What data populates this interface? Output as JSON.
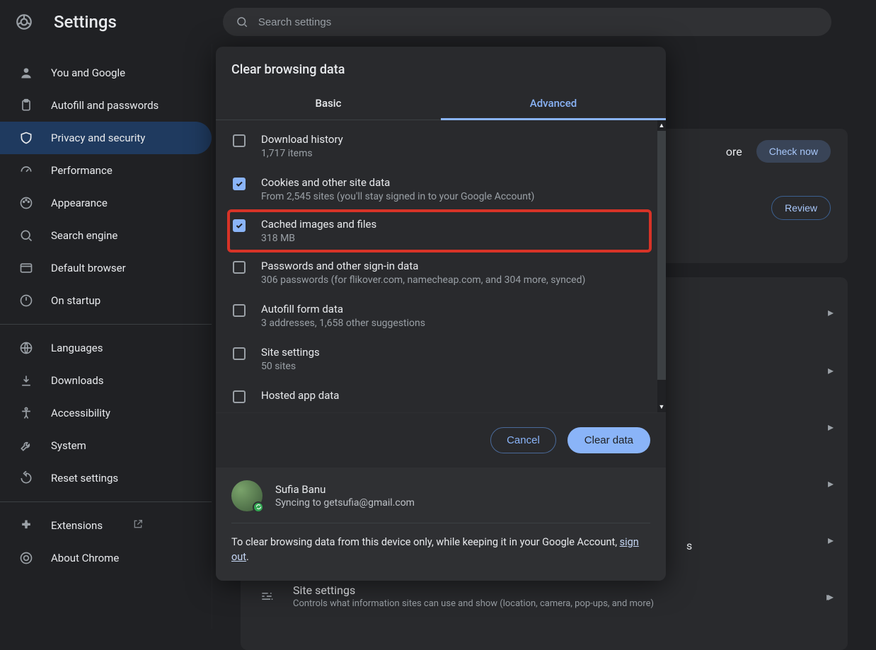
{
  "header": {
    "title": "Settings",
    "search_placeholder": "Search settings"
  },
  "sidebar": {
    "groups": [
      [
        {
          "label": "You and Google"
        },
        {
          "label": "Autofill and passwords"
        },
        {
          "label": "Privacy and security",
          "selected": true
        },
        {
          "label": "Performance"
        },
        {
          "label": "Appearance"
        },
        {
          "label": "Search engine"
        },
        {
          "label": "Default browser"
        },
        {
          "label": "On startup"
        }
      ],
      [
        {
          "label": "Languages"
        },
        {
          "label": "Downloads"
        },
        {
          "label": "Accessibility"
        },
        {
          "label": "System"
        },
        {
          "label": "Reset settings"
        }
      ],
      [
        {
          "label": "Extensions",
          "external": true
        },
        {
          "label": "About Chrome"
        }
      ]
    ]
  },
  "background": {
    "more": "ore",
    "check_now": "Check now",
    "review": "Review",
    "sites": "s",
    "site_settings_title": "Site settings",
    "site_settings_sub": "Controls what information sites can use and show (location, camera, pop-ups, and more)"
  },
  "dialog": {
    "title": "Clear browsing data",
    "tabs": {
      "basic": "Basic",
      "advanced": "Advanced"
    },
    "options": [
      {
        "title": "Download history",
        "sub": "1,717 items",
        "checked": false
      },
      {
        "title": "Cookies and other site data",
        "sub": "From 2,545 sites (you'll stay signed in to your Google Account)",
        "checked": true
      },
      {
        "title": "Cached images and files",
        "sub": "318 MB",
        "checked": true,
        "highlight": true
      },
      {
        "title": "Passwords and other sign-in data",
        "sub": "306 passwords (for flikover.com, namecheap.com, and 304 more, synced)",
        "checked": false
      },
      {
        "title": "Autofill form data",
        "sub": "3 addresses, 1,658 other suggestions",
        "checked": false
      },
      {
        "title": "Site settings",
        "sub": "50 sites",
        "checked": false
      },
      {
        "title": "Hosted app data",
        "sub": "",
        "checked": false
      }
    ],
    "cancel": "Cancel",
    "clear": "Clear data",
    "profile": {
      "name": "Sufia Banu",
      "status": "Syncing to getsufia@gmail.com"
    },
    "footer_pre": "To clear browsing data from this device only, while keeping it in your Google Account, ",
    "sign_out": "sign out",
    "footer_post": "."
  }
}
